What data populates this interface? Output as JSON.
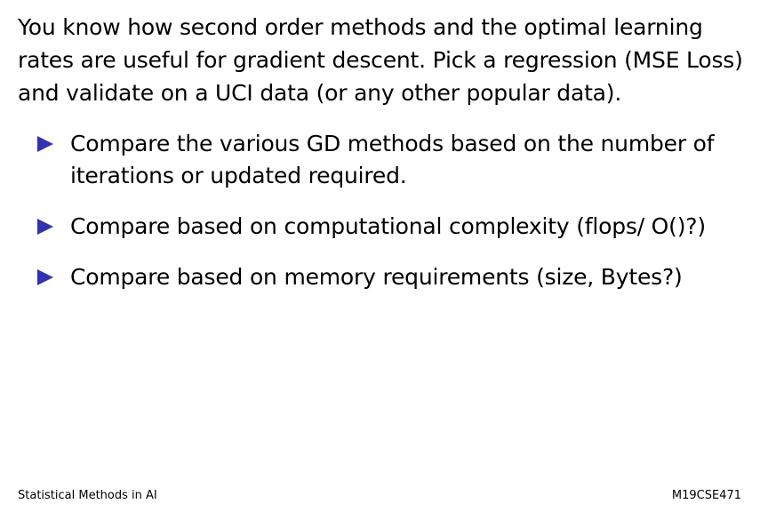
{
  "intro": {
    "lines": [
      "You know how second order methods and the optimal learning",
      "rates are useful for gradient descent. Pick a regression (MSE Loss)",
      "and validate on a UCI data (or any other popular data)."
    ]
  },
  "bullets": [
    {
      "lines": [
        "Compare the various GD methods based on the number of",
        "iterations or updated required."
      ]
    },
    {
      "lines": [
        "Compare based on computational complexity (flops/ O()?)"
      ]
    },
    {
      "lines": [
        "Compare based on memory requirements (size, Bytes?)"
      ]
    }
  ],
  "footer": {
    "left": "Statistical Methods in AI",
    "right": "M19CSE471"
  },
  "colors": {
    "bullet": "#3333b2",
    "text": "#000000",
    "background": "#ffffff"
  },
  "icons": {
    "bullet_marker": "triangle-right-icon"
  }
}
